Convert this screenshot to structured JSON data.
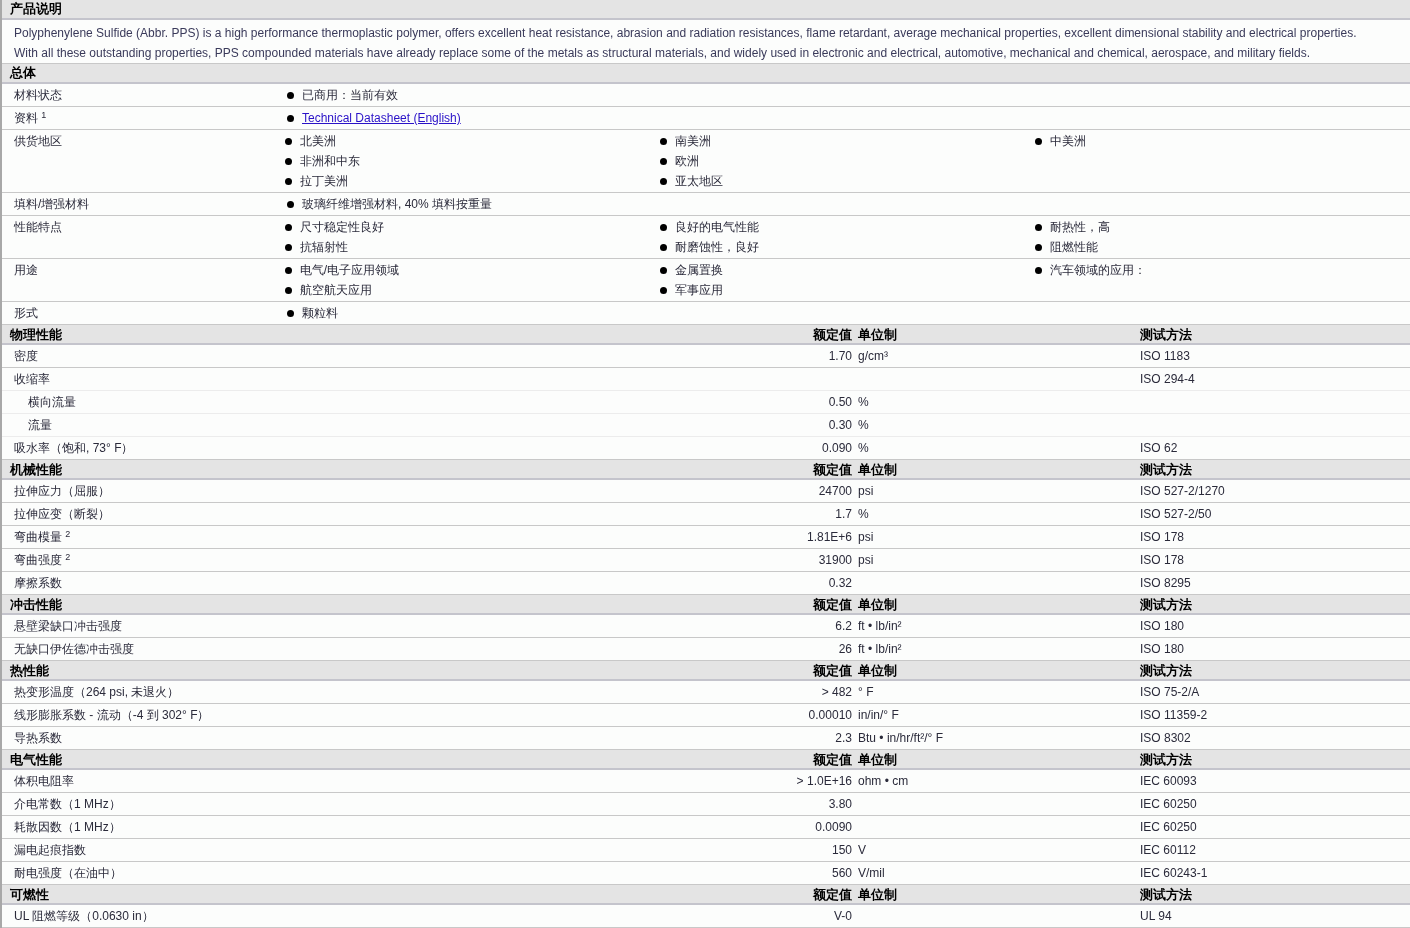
{
  "description": {
    "title": "产品说明",
    "lines": [
      "Polyphenylene Sulfide (Abbr. PPS) is a high performance thermoplastic polymer, offers excellent heat resistance, abrasion and radiation resistances, flame retardant, average mechanical properties, excellent dimensional stability and electrical properties.",
      "With all these outstanding properties, PPS compounded materials have already replace some of the metals as structural materials, and widely used in electronic and electrical, automotive, mechanical and chemical, aerospace, and military fields."
    ]
  },
  "general": {
    "title": "总体",
    "rows": [
      {
        "label": "材料状态",
        "columns": [
          [
            {
              "kind": "text",
              "text": "已商用：当前有效"
            }
          ]
        ]
      },
      {
        "label": "资料 $^{1}$",
        "columns": [
          [
            {
              "kind": "link",
              "text": "Technical Datasheet (English)"
            }
          ]
        ]
      },
      {
        "label": "供货地区",
        "columns": [
          [
            {
              "kind": "text",
              "text": "北美洲"
            },
            {
              "kind": "text",
              "text": "非洲和中东"
            },
            {
              "kind": "text",
              "text": "拉丁美洲"
            }
          ],
          [
            {
              "kind": "text",
              "text": "南美洲"
            },
            {
              "kind": "text",
              "text": "欧洲"
            },
            {
              "kind": "text",
              "text": "亚太地区"
            }
          ],
          [
            {
              "kind": "text",
              "text": "中美洲"
            }
          ]
        ]
      },
      {
        "label": "填料/增强材料",
        "columns": [
          [
            {
              "kind": "text",
              "text": "玻璃纤维增强材料, 40% 填料按重量"
            }
          ]
        ]
      },
      {
        "label": "性能特点",
        "columns": [
          [
            {
              "kind": "text",
              "text": "尺寸稳定性良好"
            },
            {
              "kind": "text",
              "text": "抗辐射性"
            }
          ],
          [
            {
              "kind": "text",
              "text": "良好的电气性能"
            },
            {
              "kind": "text",
              "text": "耐磨蚀性，良好"
            }
          ],
          [
            {
              "kind": "text",
              "text": "耐热性，高"
            },
            {
              "kind": "text",
              "text": "阻燃性能"
            }
          ]
        ]
      },
      {
        "label": "用途",
        "columns": [
          [
            {
              "kind": "text",
              "text": "电气/电子应用领域"
            },
            {
              "kind": "text",
              "text": "航空航天应用"
            }
          ],
          [
            {
              "kind": "text",
              "text": "金属置换"
            },
            {
              "kind": "text",
              "text": "军事应用"
            }
          ],
          [
            {
              "kind": "text",
              "text": "汽车领域的应用："
            }
          ]
        ]
      },
      {
        "label": "形式",
        "columns": [
          [
            {
              "kind": "text",
              "text": "颗粒料"
            }
          ]
        ]
      }
    ]
  },
  "sections": [
    {
      "title": "物理性能",
      "value_heading": "额定值",
      "unit_heading": "单位制",
      "method_heading": "测试方法",
      "rows": [
        {
          "label": "密度",
          "value": "1.70",
          "unit": "g/cm³",
          "method": "ISO 1183"
        },
        {
          "label": "收缩率",
          "method": "ISO 294-4",
          "children": [
            {
              "label": "横向流量",
              "value": "0.50",
              "unit": "%"
            },
            {
              "label": "流量",
              "value": "0.30",
              "unit": "%"
            }
          ]
        },
        {
          "label": "吸水率（饱和, 73° F）",
          "value": "0.090",
          "unit": "%",
          "method": "ISO 62"
        }
      ]
    },
    {
      "title": "机械性能",
      "value_heading": "额定值",
      "unit_heading": "单位制",
      "method_heading": "测试方法",
      "rows": [
        {
          "label": "拉伸应力（屈服）",
          "value": "24700",
          "unit": "psi",
          "method": "ISO 527-2/1270"
        },
        {
          "label": "拉伸应变（断裂）",
          "value": "1.7",
          "unit": "%",
          "method": "ISO 527-2/50"
        },
        {
          "label": "弯曲模量 $^{2}$",
          "value": "1.81E+6",
          "unit": "psi",
          "method": "ISO 178"
        },
        {
          "label": "弯曲强度 $^{2}$",
          "value": "31900",
          "unit": "psi",
          "method": "ISO 178"
        },
        {
          "label": "摩擦系数",
          "value": "0.32",
          "method": "ISO 8295"
        }
      ]
    },
    {
      "title": "冲击性能",
      "value_heading": "额定值",
      "unit_heading": "单位制",
      "method_heading": "测试方法",
      "rows": [
        {
          "label": "悬壁梁缺口冲击强度",
          "value": "6.2",
          "unit": "ft • lb/in²",
          "method": "ISO 180"
        },
        {
          "label": "无缺口伊佐德冲击强度",
          "value": "26",
          "unit": "ft • lb/in²",
          "method": "ISO 180"
        }
      ]
    },
    {
      "title": "热性能",
      "value_heading": "额定值",
      "unit_heading": "单位制",
      "method_heading": "测试方法",
      "rows": [
        {
          "label": "热变形温度（264 psi, 未退火）",
          "value": "> 482",
          "unit": "° F",
          "method": "ISO 75-2/A"
        },
        {
          "label": "线形膨胀系数 - 流动（-4 到 302° F）",
          "value": "0.00010",
          "unit": "in/in/° F",
          "method": "ISO 11359-2"
        },
        {
          "label": "导热系数",
          "value": "2.3",
          "unit": "Btu • in/hr/ft²/° F",
          "method": "ISO 8302"
        }
      ]
    },
    {
      "title": "电气性能",
      "value_heading": "额定值",
      "unit_heading": "单位制",
      "method_heading": "测试方法",
      "rows": [
        {
          "label": "体积电阻率",
          "value": "> 1.0E+16",
          "unit": "ohm • cm",
          "method": "IEC 60093"
        },
        {
          "label": "介电常数（1 MHz）",
          "value": "3.80",
          "method": "IEC 60250"
        },
        {
          "label": "耗散因数（1 MHz）",
          "value": "0.0090",
          "method": "IEC 60250"
        },
        {
          "label": "漏电起痕指数",
          "value": "150",
          "unit": "V",
          "method": "IEC 60112"
        },
        {
          "label": "耐电强度（在油中）",
          "value": "560",
          "unit": "V/mil",
          "method": "IEC 60243-1"
        }
      ]
    },
    {
      "title": "可燃性",
      "value_heading": "额定值",
      "unit_heading": "单位制",
      "method_heading": "测试方法",
      "rows": [
        {
          "label": "UL 阻燃等级（0.0630 in）",
          "value": "V-0",
          "method": "UL 94"
        }
      ]
    }
  ]
}
